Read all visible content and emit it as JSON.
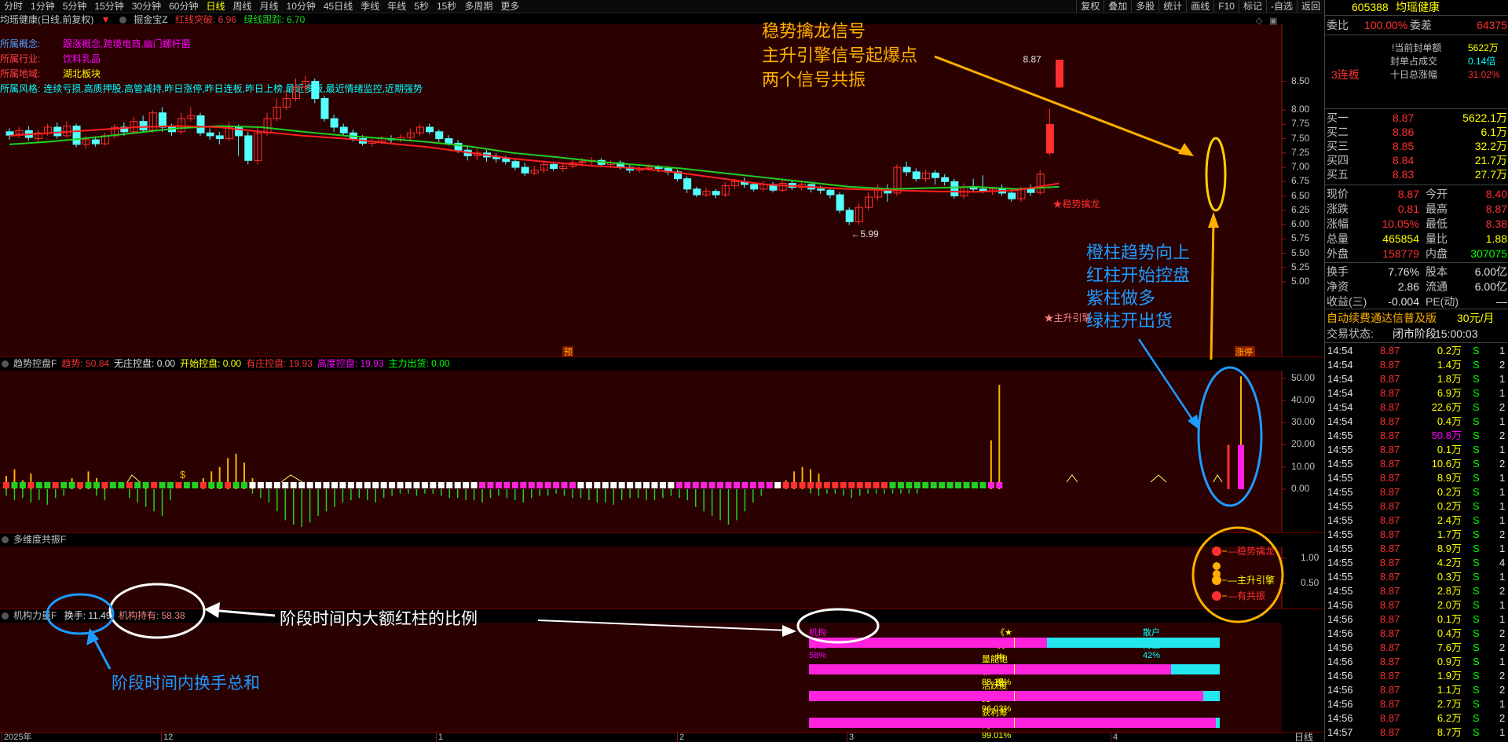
{
  "toolbar": {
    "periods": [
      "分时",
      "1分钟",
      "5分钟",
      "15分钟",
      "30分钟",
      "60分钟",
      "日线",
      "周线",
      "月线",
      "10分钟",
      "45日线",
      "季线",
      "年线",
      "5秒",
      "15秒",
      "多周期",
      "更多"
    ],
    "active": "日线",
    "right": [
      "复权",
      "叠加",
      "多股",
      "统计",
      "画线",
      "F10",
      "标记",
      "-自选",
      "返回"
    ]
  },
  "main": {
    "title": "均瑶健康(日线,前复权)",
    "indicator": "掘金宝Z",
    "red_line": "红线突破: 6.96",
    "green_line": "绿线跟踪: 6.70",
    "info": [
      {
        "k": "所属概念:",
        "v": "跟涨概念,跨境电商,幽门螺杆菌"
      },
      {
        "k": "所属行业:",
        "v": "饮料乳品"
      },
      {
        "k": "所属地域:",
        "v": "湖北板块"
      },
      {
        "k": "所属风格:",
        "v": "连续亏损,高质押股,高管减持,昨日涨停,昨日连板,昨日上榜,最近多板,最近情绪监控,近期强势"
      }
    ],
    "high_label": "8.87",
    "low_label": "←5.99",
    "mark_wenshi": "★稳势擒龙",
    "mark_zhusheng": "★主升引擎",
    "yu": "预",
    "zhangting": "涨停",
    "y_axis": [
      "8.50",
      "8.00",
      "7.75",
      "7.50",
      "7.25",
      "7.00",
      "6.75",
      "6.50",
      "6.25",
      "6.00",
      "5.75",
      "5.50",
      "5.25",
      "5.00"
    ]
  },
  "sub1": {
    "title": "趋势控盘F",
    "items": [
      {
        "k": "趋势:",
        "v": "50.84",
        "c": "#ff3030"
      },
      {
        "k": "无庄控盘:",
        "v": "0.00",
        "c": "#e0e0e0"
      },
      {
        "k": "开始控盘:",
        "v": "0.00",
        "c": "#ffff00"
      },
      {
        "k": "有庄控盘:",
        "v": "19.93",
        "c": "#ff3030"
      },
      {
        "k": "高度控盘:",
        "v": "19.93",
        "c": "#ff00ff"
      },
      {
        "k": "主力出货:",
        "v": "0.00",
        "c": "#00ff00"
      }
    ],
    "y_axis": [
      "50.00",
      "40.00",
      "30.00",
      "20.00",
      "10.00",
      "0.00"
    ]
  },
  "sub2": {
    "title": "多维度共振F",
    "y_axis": [
      "1.00",
      "0.50"
    ],
    "legend": [
      "稳势擒龙",
      "主升引擎",
      "有共振"
    ]
  },
  "sub3": {
    "title": "机构力量F",
    "turnover": "换手: 11.49",
    "inst": "机构持有: 58.38",
    "bars": [
      {
        "label": "机构力量58%",
        "center": "《★机构力量★》",
        "right": "散户力量42%",
        "pct": 58
      },
      {
        "label": "量能饱和: 88.18%",
        "pct": 88.18
      },
      {
        "label": "活跃度比: 96.03%",
        "pct": 96.03
      },
      {
        "label": "获利筹码: 99.01%",
        "pct": 99.01
      }
    ]
  },
  "xaxis": [
    "2025年",
    "12",
    "1",
    "2",
    "3",
    "4"
  ],
  "xaxis_right": "日线",
  "annotations": {
    "signal": [
      "稳势擒龙信号",
      "主升引擎信号起爆点",
      "两个信号共振"
    ],
    "columns": [
      "橙柱趋势向上",
      "红柱开始控盘",
      "紫柱做多",
      "绿柱开出货"
    ],
    "ratio": "阶段时间内大额红柱的比例",
    "turnover": "阶段时间内换手总和"
  },
  "quote": {
    "code": "605388",
    "name": "均瑶健康",
    "weibi": "委比",
    "weibi_v": "100.00%",
    "weicha": "委差",
    "weicha_v": "64375",
    "fb1": "当前封单额",
    "fb1_v": "5622万",
    "fb2": "封单占成交",
    "fb2_v": "0.14倍",
    "fb3": "十日总涨幅",
    "fb3_v": "31.02%",
    "lianban": "3连板",
    "book": [
      {
        "k": "买一",
        "p": "8.87",
        "v": "5622.1万"
      },
      {
        "k": "买二",
        "p": "8.86",
        "v": "6.1万"
      },
      {
        "k": "买三",
        "p": "8.85",
        "v": "32.2万"
      },
      {
        "k": "买四",
        "p": "8.84",
        "v": "21.7万"
      },
      {
        "k": "买五",
        "p": "8.83",
        "v": "27.7万"
      }
    ],
    "stats": [
      {
        "a": "现价",
        "av": "8.87",
        "b": "今开",
        "bv": "8.40"
      },
      {
        "a": "涨跌",
        "av": "0.81",
        "b": "最高",
        "bv": "8.87"
      },
      {
        "a": "涨幅",
        "av": "10.05%",
        "b": "最低",
        "bv": "8.38"
      },
      {
        "a": "总量",
        "av": "465854",
        "b": "量比",
        "bv": "1.88"
      },
      {
        "a": "外盘",
        "av": "158779",
        "b": "内盘",
        "bv": "307075"
      }
    ],
    "fin": [
      {
        "a": "换手",
        "av": "7.76%",
        "b": "股本",
        "bv": "6.00亿"
      },
      {
        "a": "净资",
        "av": "2.86",
        "b": "流通",
        "bv": "6.00亿"
      },
      {
        "a": "收益(三)",
        "av": "-0.004",
        "b": "PE(动)",
        "bv": "—"
      }
    ],
    "ad": "自动续费通达信普及版",
    "ad_price": "30元/月",
    "status_k": "交易状态:",
    "status_v": "闭市阶段",
    "status_t": "15:00:03",
    "ticks": [
      [
        "14:54",
        "8.87",
        "0.2万",
        "S",
        "1"
      ],
      [
        "14:54",
        "8.87",
        "1.4万",
        "S",
        "2"
      ],
      [
        "14:54",
        "8.87",
        "1.8万",
        "S",
        "1"
      ],
      [
        "14:54",
        "8.87",
        "6.9万",
        "S",
        "1"
      ],
      [
        "14:54",
        "8.87",
        "22.6万",
        "S",
        "2"
      ],
      [
        "14:54",
        "8.87",
        "0.4万",
        "S",
        "1"
      ],
      [
        "14:55",
        "8.87",
        "50.8万",
        "S",
        "2"
      ],
      [
        "14:55",
        "8.87",
        "0.1万",
        "S",
        "1"
      ],
      [
        "14:55",
        "8.87",
        "10.6万",
        "S",
        "2"
      ],
      [
        "14:55",
        "8.87",
        "8.9万",
        "S",
        "1"
      ],
      [
        "14:55",
        "8.87",
        "0.2万",
        "S",
        "1"
      ],
      [
        "14:55",
        "8.87",
        "0.2万",
        "S",
        "1"
      ],
      [
        "14:55",
        "8.87",
        "2.4万",
        "S",
        "1"
      ],
      [
        "14:55",
        "8.87",
        "1.7万",
        "S",
        "2"
      ],
      [
        "14:55",
        "8.87",
        "8.9万",
        "S",
        "1"
      ],
      [
        "14:55",
        "8.87",
        "4.2万",
        "S",
        "4"
      ],
      [
        "14:55",
        "8.87",
        "0.3万",
        "S",
        "1"
      ],
      [
        "14:55",
        "8.87",
        "2.8万",
        "S",
        "2"
      ],
      [
        "14:56",
        "8.87",
        "2.0万",
        "S",
        "1"
      ],
      [
        "14:56",
        "8.87",
        "0.1万",
        "S",
        "1"
      ],
      [
        "14:56",
        "8.87",
        "0.4万",
        "S",
        "2"
      ],
      [
        "14:56",
        "8.87",
        "7.6万",
        "S",
        "2"
      ],
      [
        "14:56",
        "8.87",
        "0.9万",
        "S",
        "1"
      ],
      [
        "14:56",
        "8.87",
        "1.9万",
        "S",
        "2"
      ],
      [
        "14:56",
        "8.87",
        "1.1万",
        "S",
        "2"
      ],
      [
        "14:56",
        "8.87",
        "2.7万",
        "S",
        "1"
      ],
      [
        "14:56",
        "8.87",
        "6.2万",
        "S",
        "2"
      ],
      [
        "14:57",
        "8.87",
        "8.7万",
        "S",
        "1"
      ]
    ]
  },
  "colors": {
    "up": "#ff3030",
    "down": "#54ffff",
    "ma_red": "#ff2020",
    "ma_green": "#22d022",
    "orange": "#ffb000",
    "blue": "#1e9bff",
    "magenta": "#ff22dd"
  }
}
